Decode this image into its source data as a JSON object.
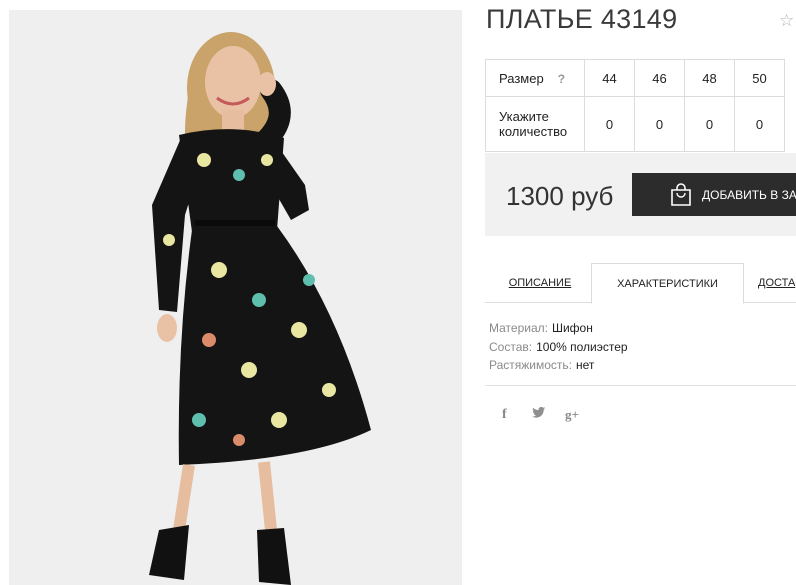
{
  "product": {
    "title": "ПЛАТЬЕ 43149",
    "favorite_icon": "star-icon"
  },
  "sizes": {
    "row_label": "Размер",
    "help": "?",
    "qty_label": "Укажите количество",
    "values": [
      "44",
      "46",
      "48",
      "50"
    ],
    "quantities": [
      "0",
      "0",
      "0",
      "0"
    ]
  },
  "purchase": {
    "price": "1300 руб",
    "add_button": "ДОБАВИТЬ В ЗА",
    "button_icon": "shopping-bag-icon"
  },
  "tabs": [
    "ОПИСАНИЕ",
    "ХАРАКТЕРИСТИКИ",
    "ДОСТА"
  ],
  "characteristics": [
    {
      "key": "Материал:",
      "value": "Шифон"
    },
    {
      "key": "Состав:",
      "value": "100% полиэстер"
    },
    {
      "key": "Растяжимость:",
      "value": "нет"
    }
  ],
  "social": {
    "facebook": "f",
    "twitter": "🐦",
    "googleplus": "g+"
  },
  "colors": {
    "button_bg": "#2c2c2c",
    "price_bg": "#f1f1f1",
    "dress": "#141414",
    "accent_flower": "#e8e6a0"
  }
}
